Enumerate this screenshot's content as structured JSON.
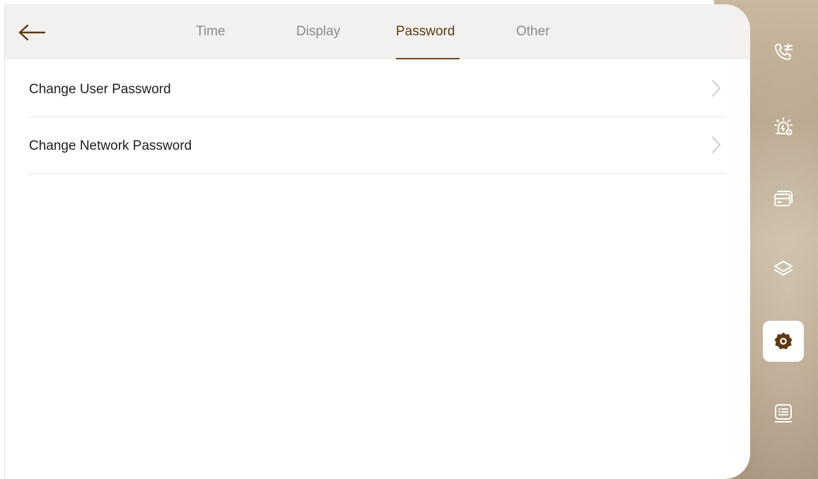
{
  "header": {
    "back_label": "",
    "tabs": [
      {
        "label": "Time",
        "active": false
      },
      {
        "label": "Display",
        "active": false
      },
      {
        "label": "Password",
        "active": true
      },
      {
        "label": "Other",
        "active": false
      }
    ]
  },
  "settings": {
    "rows": [
      {
        "label": "Change User Password"
      },
      {
        "label": "Change Network Password"
      }
    ]
  },
  "sidebar": {
    "items": [
      {
        "icon": "call-settings-icon",
        "active": false
      },
      {
        "icon": "alarm-settings-icon",
        "active": false
      },
      {
        "icon": "card-icon",
        "active": false
      },
      {
        "icon": "layers-icon",
        "active": false
      },
      {
        "icon": "gear-icon",
        "active": true
      },
      {
        "icon": "message-list-icon",
        "active": false
      }
    ]
  },
  "colors": {
    "accent": "#5b3a14",
    "tab_inactive": "#8a8a8a",
    "header_bg": "#f2f1ef"
  }
}
